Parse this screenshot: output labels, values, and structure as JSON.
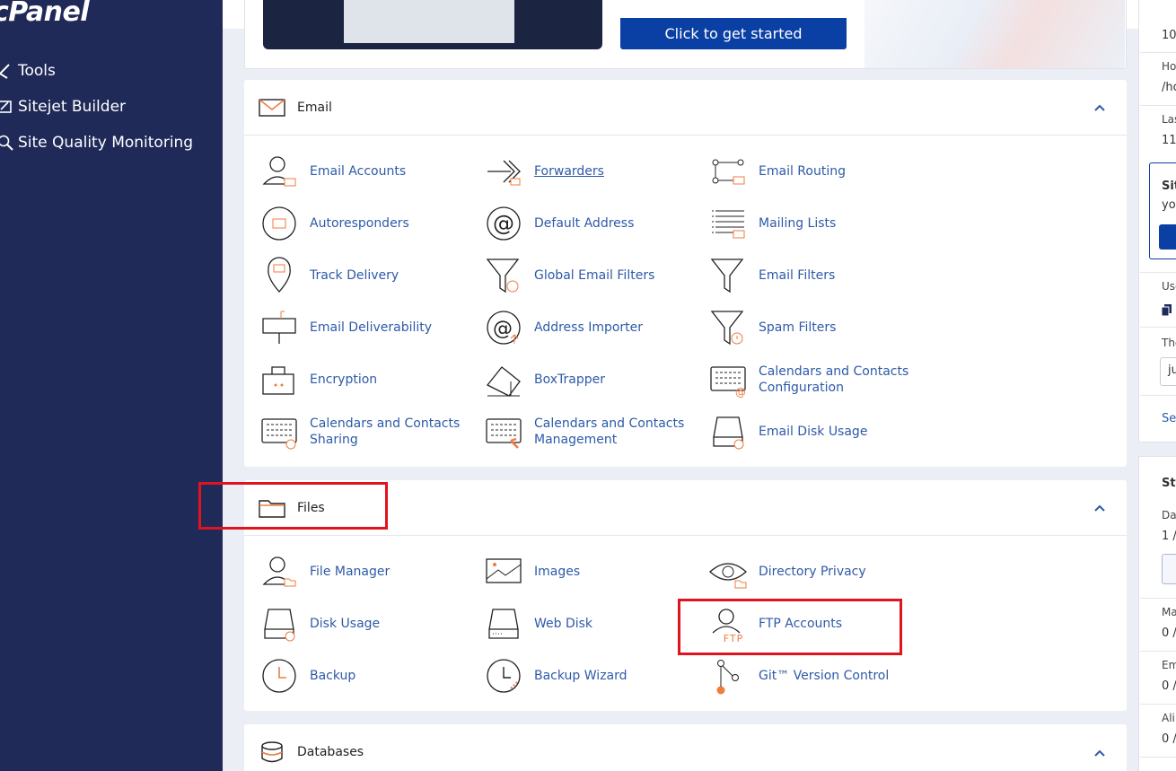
{
  "sidebar": {
    "logo": "cPanel",
    "items": [
      {
        "label": "Tools",
        "icon": "tools-icon"
      },
      {
        "label": "Sitejet Builder",
        "icon": "sitejet-icon"
      },
      {
        "label": "Site Quality Monitoring",
        "icon": "magnifier-icon"
      }
    ]
  },
  "banner": {
    "cta_label": "Click to get started"
  },
  "email": {
    "title": "Email",
    "items": [
      {
        "label": "Email Accounts",
        "icon": "email-accounts-icon"
      },
      {
        "label": "Forwarders",
        "icon": "forwarders-icon"
      },
      {
        "label": "Email Routing",
        "icon": "email-routing-icon"
      },
      {
        "label": "Autoresponders",
        "icon": "autoresponders-icon"
      },
      {
        "label": "Default Address",
        "icon": "default-address-icon"
      },
      {
        "label": "Mailing Lists",
        "icon": "mailing-lists-icon"
      },
      {
        "label": "Track Delivery",
        "icon": "track-delivery-icon"
      },
      {
        "label": "Global Email Filters",
        "icon": "global-email-filters-icon"
      },
      {
        "label": "Email Filters",
        "icon": "email-filters-icon"
      },
      {
        "label": "Email Deliverability",
        "icon": "email-deliverability-icon"
      },
      {
        "label": "Address Importer",
        "icon": "address-importer-icon"
      },
      {
        "label": "Spam Filters",
        "icon": "spam-filters-icon"
      },
      {
        "label": "Encryption",
        "icon": "encryption-icon"
      },
      {
        "label": "BoxTrapper",
        "icon": "boxtrapper-icon"
      },
      {
        "label": "Calendars and Contacts Configuration",
        "icon": "calendars-config-icon"
      },
      {
        "label": "Calendars and Contacts Sharing",
        "icon": "calendars-sharing-icon"
      },
      {
        "label": "Calendars and Contacts Management",
        "icon": "calendars-management-icon"
      },
      {
        "label": "Email Disk Usage",
        "icon": "email-disk-usage-icon"
      }
    ]
  },
  "files": {
    "title": "Files",
    "items": [
      {
        "label": "File Manager",
        "icon": "file-manager-icon"
      },
      {
        "label": "Images",
        "icon": "images-icon"
      },
      {
        "label": "Directory Privacy",
        "icon": "directory-privacy-icon"
      },
      {
        "label": "Disk Usage",
        "icon": "disk-usage-icon"
      },
      {
        "label": "Web Disk",
        "icon": "web-disk-icon"
      },
      {
        "label": "FTP Accounts",
        "icon": "ftp-accounts-icon"
      },
      {
        "label": "Backup",
        "icon": "backup-icon"
      },
      {
        "label": "Backup Wizard",
        "icon": "backup-wizard-icon"
      },
      {
        "label": "Git™ Version Control",
        "icon": "git-icon"
      }
    ]
  },
  "databases": {
    "title": "Databases"
  },
  "right_column": {
    "texts": [
      "10",
      "Ho",
      "/ho",
      "Las",
      "11",
      "Sit",
      "you",
      "Use",
      "The",
      "ju",
      "Se",
      "Sta",
      "Da",
      "1 /",
      "Ma",
      "0 /",
      "Em",
      "0 /",
      "Ali",
      "0 /"
    ]
  },
  "colors": {
    "sidebar_bg": "#1f2a58",
    "link": "#2e5aa8",
    "accent_orange": "#f07b3f",
    "annotation_red": "#e0141e",
    "cta_blue": "#0a3fa3"
  }
}
